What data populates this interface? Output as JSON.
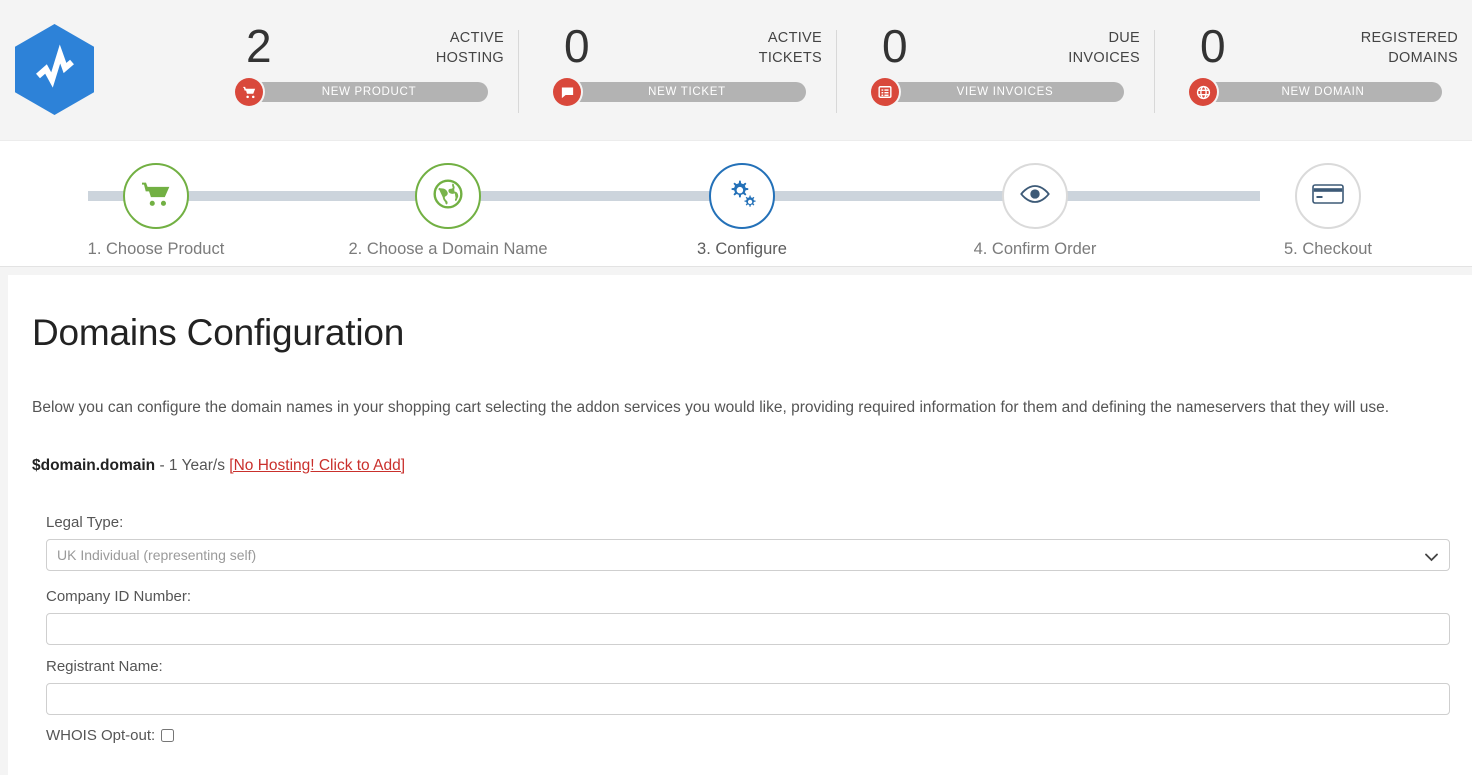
{
  "brand": {
    "logo_icon": "hexagon-pulse-logo",
    "logo_color": "#2d82d8"
  },
  "stats": {
    "accent_color": "#d9483b",
    "button_bg": "#b3b3b3",
    "items": [
      {
        "count": "2",
        "label_line1": "ACTIVE",
        "label_line2": "HOSTING",
        "button_label": "NEW PRODUCT",
        "icon": "shopping-cart-icon"
      },
      {
        "count": "0",
        "label_line1": "ACTIVE",
        "label_line2": "TICKETS",
        "button_label": "NEW TICKET",
        "icon": "speech-bubble-icon"
      },
      {
        "count": "0",
        "label_line1": "DUE",
        "label_line2": "INVOICES",
        "button_label": "VIEW INVOICES",
        "icon": "invoice-list-icon"
      },
      {
        "count": "0",
        "label_line1": "REGISTERED",
        "label_line2": "DOMAINS",
        "button_label": "NEW DOMAIN",
        "icon": "globe-icon"
      }
    ]
  },
  "steps": {
    "done_color": "#72b043",
    "active_color": "#2471b8",
    "pending_color": "#dadada",
    "line_color": "#ccd4dc",
    "items": [
      {
        "label": "1. Choose Product",
        "state": "done",
        "icon": "shopping-cart-icon"
      },
      {
        "label": "2. Choose a Domain Name",
        "state": "done",
        "icon": "globe-icon"
      },
      {
        "label": "3. Configure",
        "state": "active",
        "icon": "gears-icon"
      },
      {
        "label": "4. Confirm Order",
        "state": "pending",
        "icon": "eye-icon"
      },
      {
        "label": "5. Checkout",
        "state": "pending",
        "icon": "credit-card-icon"
      }
    ]
  },
  "content": {
    "title": "Domains Configuration",
    "description": "Below you can configure the domain names in your shopping cart selecting the addon services you would like, providing required information for them and defining the nameservers that they will use.",
    "domain_name": "$domain.domain",
    "domain_term": " - 1 Year/s ",
    "domain_warning": "[No Hosting! Click to Add]",
    "warning_color": "#c9302c"
  },
  "form": {
    "legal_type": {
      "label": "Legal Type:",
      "value": "UK Individual (representing self)",
      "options": [
        "UK Individual (representing self)"
      ]
    },
    "company_id": {
      "label": "Company ID Number:",
      "value": "",
      "placeholder": ""
    },
    "registrant_name": {
      "label": "Registrant Name:",
      "value": "",
      "placeholder": ""
    },
    "whois_optout": {
      "label": "WHOIS Opt-out:",
      "checked": false
    }
  }
}
